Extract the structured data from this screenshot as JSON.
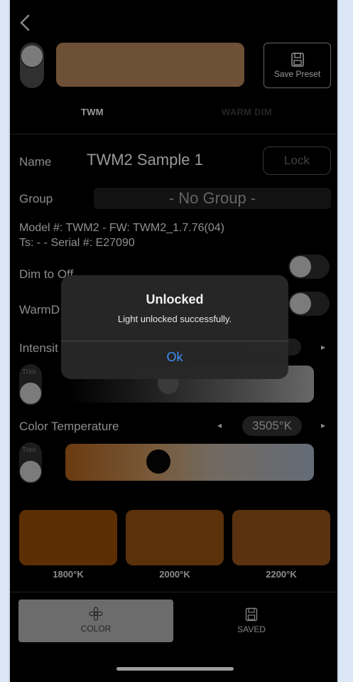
{
  "header": {
    "back_icon": "chevron-left-icon",
    "save_preset_label": "Save Preset",
    "save_preset_icon": "floppy-disk-icon",
    "preview_color": "#a87c52"
  },
  "tabs": [
    {
      "label": "TWM",
      "active": true
    },
    {
      "label": "WARM DIM",
      "active": false
    }
  ],
  "fixture": {
    "name_label": "Name",
    "name_value": "TWM2 Sample 1",
    "lock_label": "Lock",
    "group_label": "Group",
    "group_value": "- No Group -",
    "model_line": "Model #: TWM2 - FW: TWM2_1.7.76(04)",
    "serial_line": "Ts: - - Serial #: E27090"
  },
  "settings": {
    "dim_to_off_label": "Dim to Off",
    "warm_dim_label": "WarmD",
    "intensity_label": "Intensit",
    "color_temp_label": "Color Temperature",
    "color_temp_value": "3505°K",
    "trim_label": "Trim",
    "arrow_left": "◂",
    "arrow_right": "▸"
  },
  "presets": [
    {
      "label": "1800°K",
      "color": "#8e4706"
    },
    {
      "label": "2000°K",
      "color": "#8d4c12"
    },
    {
      "label": "2200°K",
      "color": "#8b4e1a"
    }
  ],
  "bottom_nav": {
    "color_label": "COLOR",
    "color_icon": "flower-icon",
    "saved_label": "SAVED",
    "saved_icon": "floppy-disk-icon"
  },
  "dialog": {
    "title": "Unlocked",
    "message": "Light unlocked successfully.",
    "ok_label": "Ok"
  }
}
